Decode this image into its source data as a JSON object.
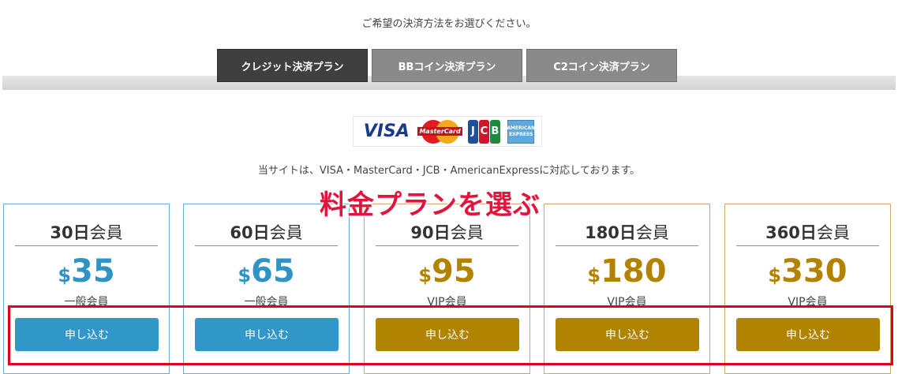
{
  "prompt": "ご希望の決済方法をお選びください。",
  "tabs": [
    {
      "label": "クレジット決済プラン",
      "active": true
    },
    {
      "label": "BBコイン決済プラン",
      "active": false
    },
    {
      "label": "C2コイン決済プラン",
      "active": false
    }
  ],
  "card_logos": {
    "visa": "VISA",
    "mastercard": "MasterCard",
    "jcb": [
      "J",
      "C",
      "B"
    ],
    "amex": [
      "AMERICAN",
      "EXPRESS"
    ]
  },
  "support_text": "当サイトは、VISA・MasterCard・JCB・AmericanExpressに対応しております。",
  "overlay_text": "料金プランを選ぶ",
  "currency_symbol": "$",
  "plans": [
    {
      "days": "30日",
      "unit": "会員",
      "price": "35",
      "tier": "一般会員",
      "button": "申し込む",
      "style": "blue"
    },
    {
      "days": "60日",
      "unit": "会員",
      "price": "65",
      "tier": "一般会員",
      "button": "申し込む",
      "style": "blue"
    },
    {
      "days": "90日",
      "unit": "会員",
      "price": "95",
      "tier": "VIP会員",
      "button": "申し込む",
      "style": "gold"
    },
    {
      "days": "180日",
      "unit": "会員",
      "price": "180",
      "tier": "VIP会員",
      "button": "申し込む",
      "style": "gold"
    },
    {
      "days": "360日",
      "unit": "会員",
      "price": "330",
      "tier": "VIP会員",
      "button": "申し込む",
      "style": "gold"
    }
  ],
  "colors": {
    "blue": "#3196c8",
    "gold": "#b08300",
    "highlight": "#e1001e",
    "active_tab": "#3f3f3f",
    "inactive_tab": "#8a8a8a"
  }
}
